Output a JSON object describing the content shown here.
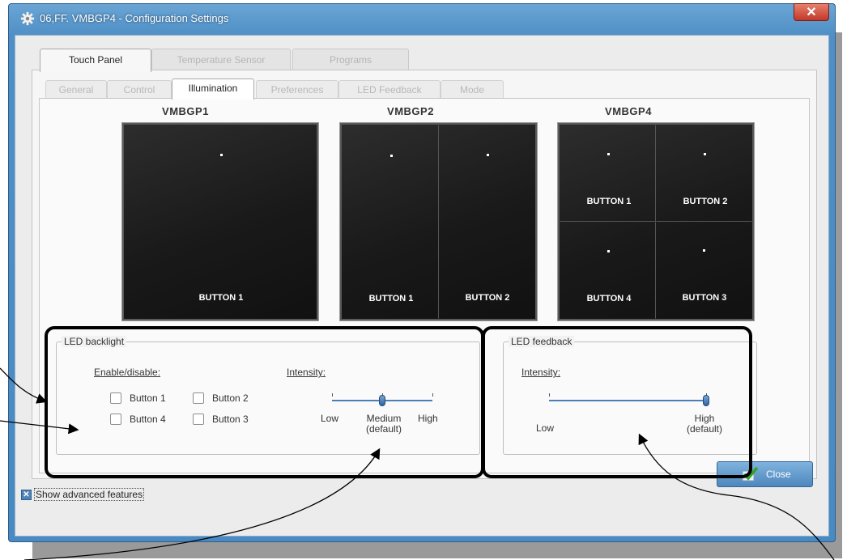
{
  "window": {
    "title": "06,FF. VMBGP4 - Configuration Settings",
    "close_glyph": "✕"
  },
  "top_tabs": [
    "Touch Panel",
    "Temperature Sensor",
    "Programs"
  ],
  "sub_tabs": [
    "General",
    "Control",
    "Illumination",
    "Preferences",
    "LED Feedback",
    "Mode"
  ],
  "panels": {
    "p1": {
      "title": "VMBGP1",
      "buttons": [
        "BUTTON 1"
      ]
    },
    "p2": {
      "title": "VMBGP2",
      "buttons": [
        "BUTTON 1",
        "BUTTON 2"
      ]
    },
    "p4": {
      "title": "VMBGP4",
      "buttons": [
        "BUTTON 1",
        "BUTTON 2",
        "BUTTON 4",
        "BUTTON 3"
      ]
    }
  },
  "backlight": {
    "legend": "LED backlight",
    "enable_label": "Enable/disable:",
    "checkboxes": [
      {
        "label": "Button 1",
        "checked": false
      },
      {
        "label": "Button 2",
        "checked": false
      },
      {
        "label": "Button 4",
        "checked": false
      },
      {
        "label": "Button 3",
        "checked": false
      }
    ],
    "intensity_label": "Intensity:",
    "slider_low": "Low",
    "slider_medium": "Medium",
    "slider_medium_note": "(default)",
    "slider_high": "High",
    "slider_value": "Medium"
  },
  "feedback": {
    "legend": "LED feedback",
    "intensity_label": "Intensity:",
    "slider_low": "Low",
    "slider_high": "High",
    "slider_high_note": "(default)",
    "slider_value": "High"
  },
  "advanced": {
    "label": "Show advanced features",
    "checked": true,
    "glyph": "✕"
  },
  "close_button": {
    "label": "Close"
  },
  "colors": {
    "title_bar": "#4a8ac2",
    "annotation": "#000000",
    "slider": "#4a7fb8"
  }
}
